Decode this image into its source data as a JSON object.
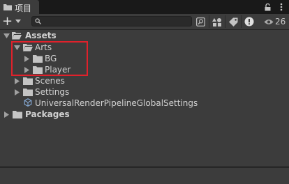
{
  "tab": {
    "title": "项目",
    "icon": "folder-icon"
  },
  "window_menu": {
    "lock_icon": "lock-icon",
    "more_icon": "kebab-menu-icon"
  },
  "toolbar": {
    "add_label": "+",
    "search": {
      "value": "",
      "placeholder": ""
    },
    "buttons": [
      "search-by-type-icon",
      "filter-by-type-icon",
      "filter-by-label-icon",
      "console-warning-icon"
    ],
    "hidden_packages_count": "26"
  },
  "tree": [
    {
      "label": "Assets",
      "level": 0,
      "expanded": true,
      "bold": true,
      "kind": "folder"
    },
    {
      "label": "Arts",
      "level": 1,
      "expanded": true,
      "bold": false,
      "kind": "folder"
    },
    {
      "label": "BG",
      "level": 2,
      "expanded": false,
      "bold": false,
      "kind": "folder"
    },
    {
      "label": "Player",
      "level": 2,
      "expanded": false,
      "bold": false,
      "kind": "folder"
    },
    {
      "label": "Scenes",
      "level": 1,
      "expanded": false,
      "bold": false,
      "kind": "folder"
    },
    {
      "label": "Settings",
      "level": 1,
      "expanded": false,
      "bold": false,
      "kind": "folder"
    },
    {
      "label": "UniversalRenderPipelineGlobalSettings",
      "level": 1,
      "expanded": null,
      "bold": false,
      "kind": "asset"
    },
    {
      "label": "Packages",
      "level": 0,
      "expanded": false,
      "bold": true,
      "kind": "folder"
    }
  ],
  "colors": {
    "panel": "#3c3c3c",
    "background": "#191919",
    "highlight": "#e0212b",
    "text": "#d2d2d2"
  }
}
